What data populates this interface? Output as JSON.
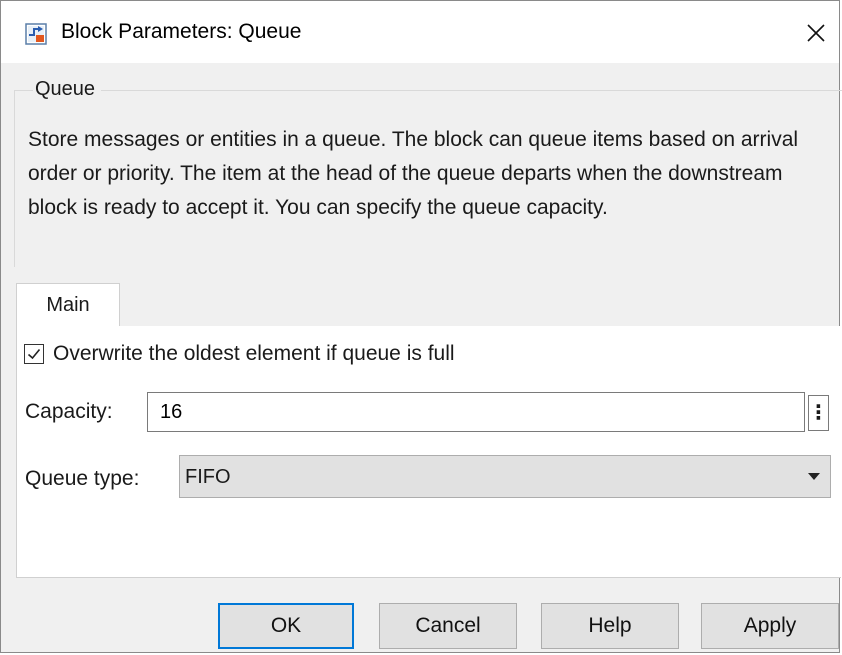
{
  "window": {
    "title": "Block Parameters: Queue",
    "close_glyph": "✕",
    "icon": "simulink-block-icon"
  },
  "group": {
    "legend": "Queue",
    "description": "Store messages or entities in a queue. The block can queue items based on arrival order or priority. The item at the head of the queue departs when the downstream block is ready to accept it. You can specify the queue capacity."
  },
  "tabs": [
    {
      "label": "Main",
      "selected": true
    }
  ],
  "main": {
    "overwrite": {
      "label": "Overwrite the oldest element if queue is full",
      "checked": true
    },
    "capacity": {
      "label": "Capacity:",
      "value": "16"
    },
    "more_glyph": "⋮",
    "queue_type": {
      "label": "Queue type:",
      "value": "FIFO"
    }
  },
  "buttons": {
    "ok": "OK",
    "cancel": "Cancel",
    "help": "Help",
    "apply": "Apply"
  },
  "colors": {
    "default_button_border": "#0078d7",
    "dialog_bg": "#f0f0f0",
    "button_bg": "#e1e1e1"
  }
}
